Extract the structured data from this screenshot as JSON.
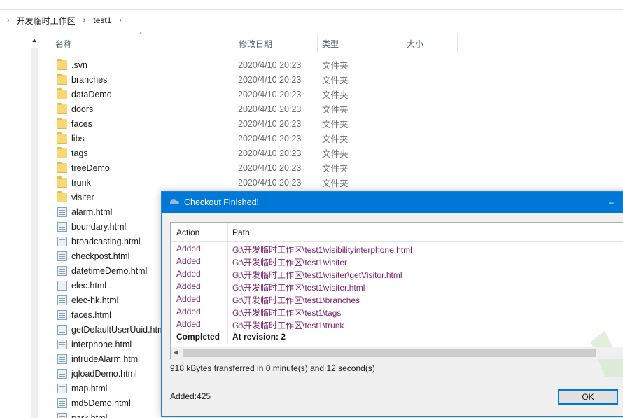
{
  "address": {
    "crumbs": [
      "开发临时工作区",
      "test1"
    ]
  },
  "columns": {
    "name": "名称",
    "date": "修改日期",
    "type": "类型",
    "size": "大小"
  },
  "files": [
    {
      "name": ".svn",
      "kind": "folder",
      "date": "2020/4/10 20:23",
      "type": "文件夹"
    },
    {
      "name": "branches",
      "kind": "folder",
      "date": "2020/4/10 20:23",
      "type": "文件夹"
    },
    {
      "name": "dataDemo",
      "kind": "folder",
      "date": "2020/4/10 20:23",
      "type": "文件夹"
    },
    {
      "name": "doors",
      "kind": "folder",
      "date": "2020/4/10 20:23",
      "type": "文件夹"
    },
    {
      "name": "faces",
      "kind": "folder",
      "date": "2020/4/10 20:23",
      "type": "文件夹"
    },
    {
      "name": "libs",
      "kind": "folder",
      "date": "2020/4/10 20:23",
      "type": "文件夹"
    },
    {
      "name": "tags",
      "kind": "folder",
      "date": "2020/4/10 20:23",
      "type": "文件夹"
    },
    {
      "name": "treeDemo",
      "kind": "folder",
      "date": "2020/4/10 20:23",
      "type": "文件夹"
    },
    {
      "name": "trunk",
      "kind": "folder",
      "date": "2020/4/10 20:23",
      "type": "文件夹"
    },
    {
      "name": "visiter",
      "kind": "folder",
      "date": "",
      "type": ""
    },
    {
      "name": "alarm.html",
      "kind": "file",
      "date": "",
      "type": ""
    },
    {
      "name": "boundary.html",
      "kind": "file",
      "date": "",
      "type": ""
    },
    {
      "name": "broadcasting.html",
      "kind": "file",
      "date": "",
      "type": ""
    },
    {
      "name": "checkpost.html",
      "kind": "file",
      "date": "",
      "type": ""
    },
    {
      "name": "datetimeDemo.html",
      "kind": "file",
      "date": "",
      "type": ""
    },
    {
      "name": "elec.html",
      "kind": "file",
      "date": "",
      "type": ""
    },
    {
      "name": "elec-hk.html",
      "kind": "file",
      "date": "",
      "type": ""
    },
    {
      "name": "faces.html",
      "kind": "file",
      "date": "",
      "type": ""
    },
    {
      "name": "getDefaultUserUuid.htm",
      "kind": "file",
      "date": "",
      "type": ""
    },
    {
      "name": "interphone.html",
      "kind": "file",
      "date": "",
      "type": ""
    },
    {
      "name": "intrudeAlarm.html",
      "kind": "file",
      "date": "",
      "type": ""
    },
    {
      "name": "jqloadDemo.html",
      "kind": "file",
      "date": "",
      "type": ""
    },
    {
      "name": "map.html",
      "kind": "file",
      "date": "",
      "type": ""
    },
    {
      "name": "md5Demo.html",
      "kind": "file",
      "date": "",
      "type": ""
    },
    {
      "name": "park.html",
      "kind": "file",
      "date": "",
      "type": ""
    }
  ],
  "dialog": {
    "title": "Checkout Finished!",
    "minimize": "–",
    "list_header": {
      "action": "Action",
      "path": "Path"
    },
    "rows": [
      {
        "action": "Added",
        "path": "G:\\开发临时工作区\\test1\\visibilityinterphone.html",
        "done": false
      },
      {
        "action": "Added",
        "path": "G:\\开发临时工作区\\test1\\visiter",
        "done": false
      },
      {
        "action": "Added",
        "path": "G:\\开发临时工作区\\test1\\visiter\\getVisitor.html",
        "done": false
      },
      {
        "action": "Added",
        "path": "G:\\开发临时工作区\\test1\\visiter.html",
        "done": false
      },
      {
        "action": "Added",
        "path": "G:\\开发临时工作区\\test1\\branches",
        "done": false
      },
      {
        "action": "Added",
        "path": "G:\\开发临时工作区\\test1\\tags",
        "done": false
      },
      {
        "action": "Added",
        "path": "G:\\开发临时工作区\\test1\\trunk",
        "done": false
      },
      {
        "action": "Completed",
        "path": "At revision: 2",
        "done": true
      }
    ],
    "transfer_text": "918 kBytes transferred in 0 minute(s) and 12 second(s)",
    "added_text": "Added:425",
    "ok_label": "OK"
  },
  "colors": {
    "accent": "#0078d7",
    "added_text": "#7a1f6e",
    "folder": "#f8d775"
  }
}
